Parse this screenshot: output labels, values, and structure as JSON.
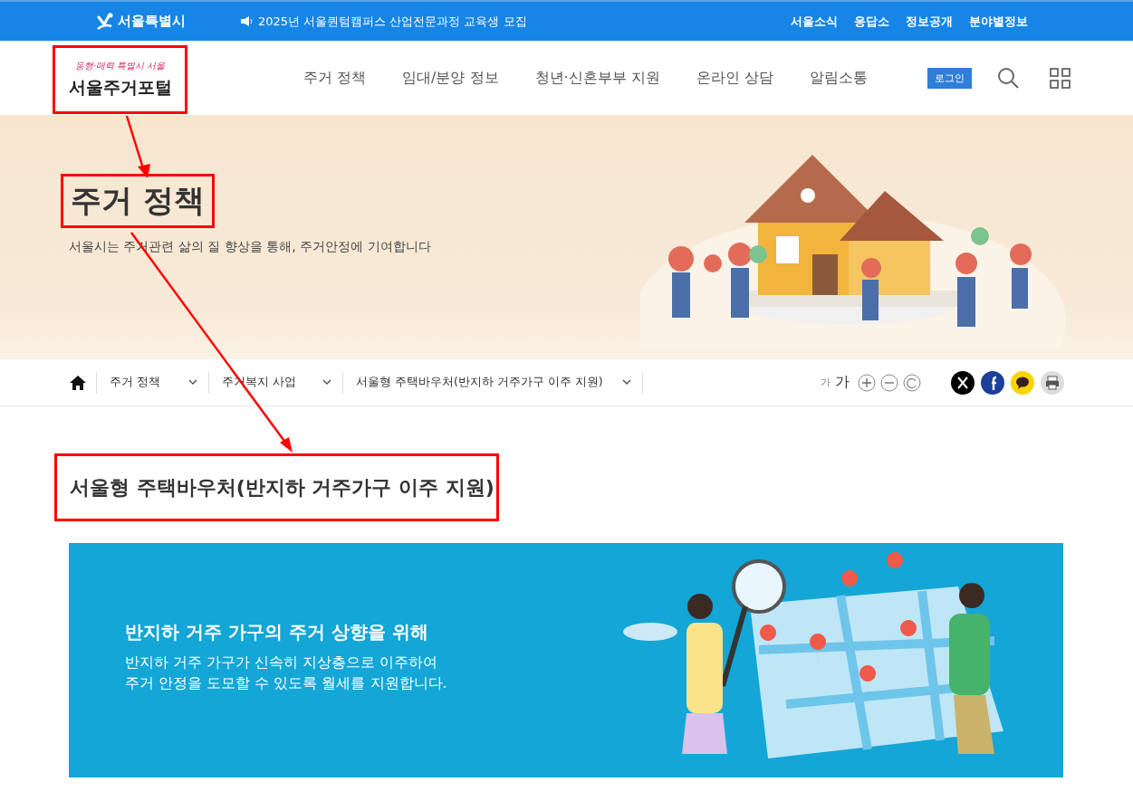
{
  "top_bar": {
    "city_logo": "서울특별시",
    "notice": "2025년 서울퀀텀캠퍼스 산업전문과정 교육생 모집",
    "links": [
      "서울소식",
      "응답소",
      "정보공개",
      "분야별정보"
    ]
  },
  "header": {
    "slogan": "동행·매력 특별시 서울",
    "site_name": "서울주거포털",
    "highlighted": true,
    "nav": [
      {
        "label": "주거 정책",
        "selected": false
      },
      {
        "label": "임대/분양 정보",
        "selected": false
      },
      {
        "label": "청년·신혼부부 지원",
        "selected": false
      },
      {
        "label": "온라인 상담",
        "selected": false
      },
      {
        "label": "알림소통",
        "selected": false
      }
    ],
    "login": "로그인"
  },
  "hero": {
    "title": "주거 정책",
    "highlighted": true,
    "subtitle": "서울시는 주거관련 삶의 질 향상을 통해, 주거안정에 기여합니다"
  },
  "breadcrumb": {
    "items": [
      "주거 정책",
      "주거복지 사업",
      "서울형 주택바우처(반지하 거주가구 이주 지원)"
    ],
    "font_small": "가",
    "font_large": "가"
  },
  "page_title": {
    "text": "서울형 주택바우처(반지하 거주가구 이주 지원)",
    "highlighted": true
  },
  "banner": {
    "heading": "반지하 거주 가구의 주거 상향을 위해",
    "lines": [
      "반지하 거주 가구가 신속히 지상층으로 이주하여",
      "주거 안정을 도모할 수 있도록 월세를 지원합니다."
    ]
  },
  "annotation": {
    "arrows": true
  }
}
